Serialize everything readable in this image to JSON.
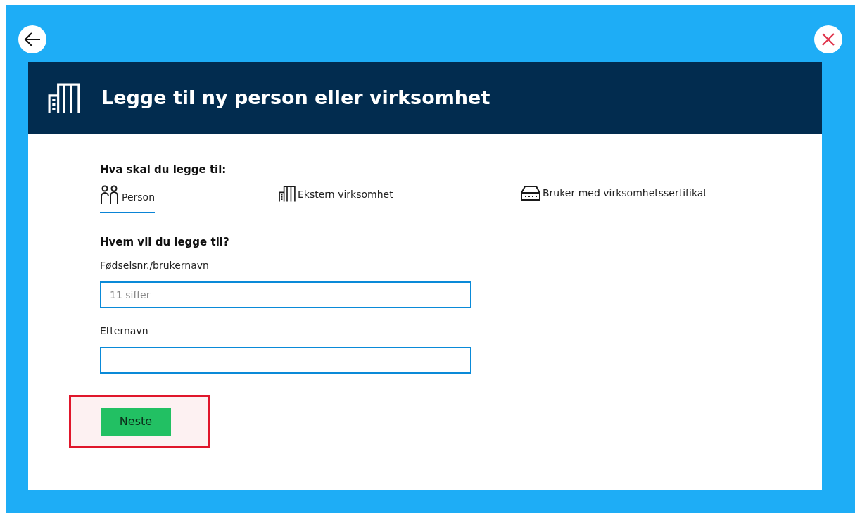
{
  "dialog": {
    "title": "Legge til ny person eller virksomhet"
  },
  "type_question": "Hva skal du legge til:",
  "types": [
    {
      "label": "Person",
      "kind": "person",
      "selected": true
    },
    {
      "label": "Ekstern virksomhet",
      "kind": "company",
      "selected": false
    },
    {
      "label": "Bruker med virksomhetssertifikat",
      "kind": "certificate",
      "selected": false
    }
  ],
  "who_question": "Hvem vil du legge til?",
  "fields": [
    {
      "label": "Fødselsnr./brukernavn",
      "placeholder": "11 siffer"
    },
    {
      "label": "Etternavn"
    }
  ],
  "next_button": {
    "label": "Neste",
    "highlighted": true
  }
}
